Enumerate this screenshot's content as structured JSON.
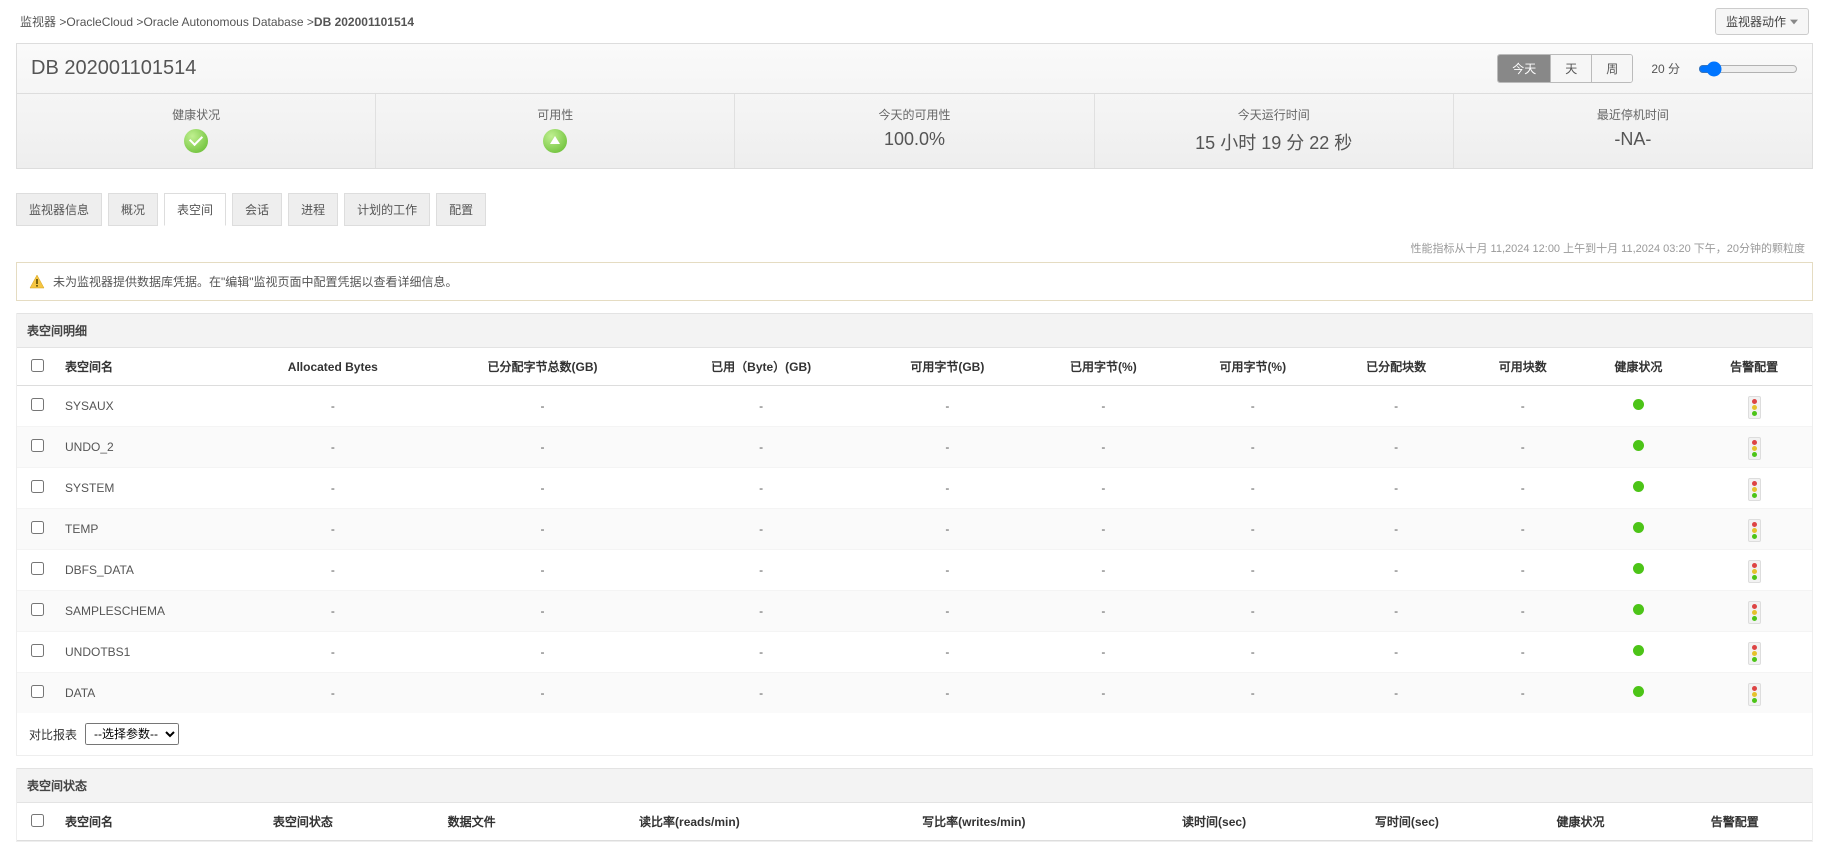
{
  "breadcrumb": {
    "root": "监视器",
    "sep": ">",
    "lvl1": "OracleCloud",
    "lvl2": "Oracle Autonomous Database",
    "current": "DB 202001101514"
  },
  "actions_btn": "监视器动作",
  "header": {
    "title": "DB 202001101514",
    "seg": {
      "today": "今天",
      "day": "天",
      "week": "周"
    },
    "granularity": "20 分"
  },
  "status": {
    "health_label": "健康状况",
    "avail_label": "可用性",
    "today_avail_label": "今天的可用性",
    "today_avail_value": "100.0%",
    "today_run_label": "今天运行时间",
    "today_run_value": "15 小时 19 分 22 秒",
    "last_down_label": "最近停机时间",
    "last_down_value": "-NA-"
  },
  "tabs": {
    "info": "监视器信息",
    "overview": "概况",
    "tablespace": "表空间",
    "session": "会话",
    "process": "进程",
    "scheduled": "计划的工作",
    "config": "配置"
  },
  "granularity_note": "性能指标从十月 11,2024 12:00 上午到十月 11,2024 03:20 下午，20分钟的颗粒度",
  "warning": "未为监视器提供数据库凭据。在\"编辑\"监视页面中配置凭据以查看详细信息。",
  "section_detail_title": "表空间明细",
  "detail_columns": {
    "name": "表空间名",
    "alloc": "Allocated Bytes",
    "alloc_gb": "已分配字节总数(GB)",
    "used_gb": "已用（Byte）(GB)",
    "free_gb": "可用字节(GB)",
    "used_pct": "已用字节(%)",
    "free_pct": "可用字节(%)",
    "alloc_blocks": "已分配块数",
    "free_blocks": "可用块数",
    "health": "健康状况",
    "alarm": "告警配置"
  },
  "detail_rows": [
    {
      "name": "SYSAUX"
    },
    {
      "name": "UNDO_2"
    },
    {
      "name": "SYSTEM"
    },
    {
      "name": "TEMP"
    },
    {
      "name": "DBFS_DATA"
    },
    {
      "name": "SAMPLESCHEMA"
    },
    {
      "name": "UNDOTBS1"
    },
    {
      "name": "DATA"
    }
  ],
  "dash": "-",
  "compare_label": "对比报表",
  "compare_placeholder": "--选择参数--",
  "section_status_title": "表空间状态",
  "status_columns": {
    "name": "表空间名",
    "state": "表空间状态",
    "datafile": "数据文件",
    "read_rate": "读比率(reads/min)",
    "write_rate": "写比率(writes/min)",
    "read_time": "读时间(sec)",
    "write_time": "写时间(sec)",
    "health": "健康状况",
    "alarm": "告警配置"
  }
}
